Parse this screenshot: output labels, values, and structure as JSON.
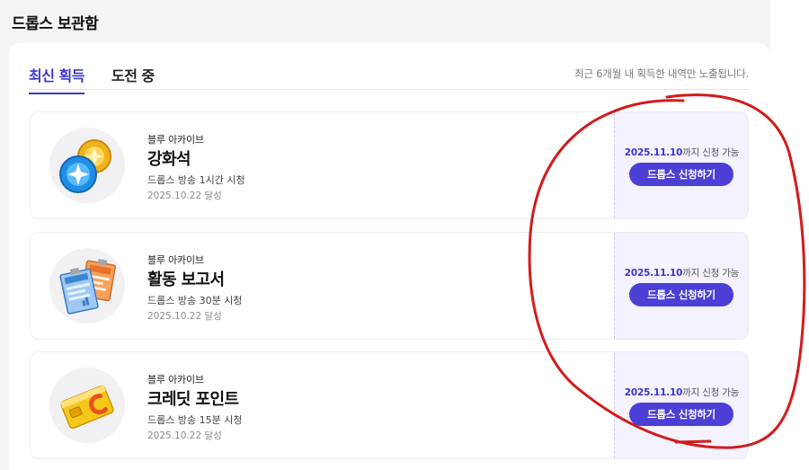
{
  "page": {
    "title": "드롭스 보관함"
  },
  "tabs": [
    {
      "label": "최신 획득",
      "active": true
    },
    {
      "label": "도전 중",
      "active": false
    }
  ],
  "notice": "최근 6개월 내 획득한 내역만 노출됩니다.",
  "deadline_suffix": "까지 신청 가능",
  "cards": [
    {
      "source": "블루 아카이브",
      "name": "강화석",
      "condition": "드롭스 방송 1시간 시청",
      "achieved": "2025.10.22 달성",
      "deadline_date": "2025.11.10",
      "button_label": "드롭스 신청하기",
      "icon": "enhancement-stone-icon"
    },
    {
      "source": "블루 아카이브",
      "name": "활동 보고서",
      "condition": "드롭스 방송 30분 시청",
      "achieved": "2025.10.22 달성",
      "deadline_date": "2025.11.10",
      "button_label": "드롭스 신청하기",
      "icon": "activity-report-icon"
    },
    {
      "source": "블루 아카이브",
      "name": "크레딧 포인트",
      "condition": "드롭스 방송 15분 시청",
      "achieved": "2025.10.22 달성",
      "deadline_date": "2025.11.10",
      "button_label": "드롭스 신청하기",
      "icon": "credit-card-icon"
    }
  ],
  "colors": {
    "accent": "#3c35c9",
    "button": "#4b3fd6",
    "side_panel": "#f3f2fd",
    "annotation": "#d21b1b"
  }
}
